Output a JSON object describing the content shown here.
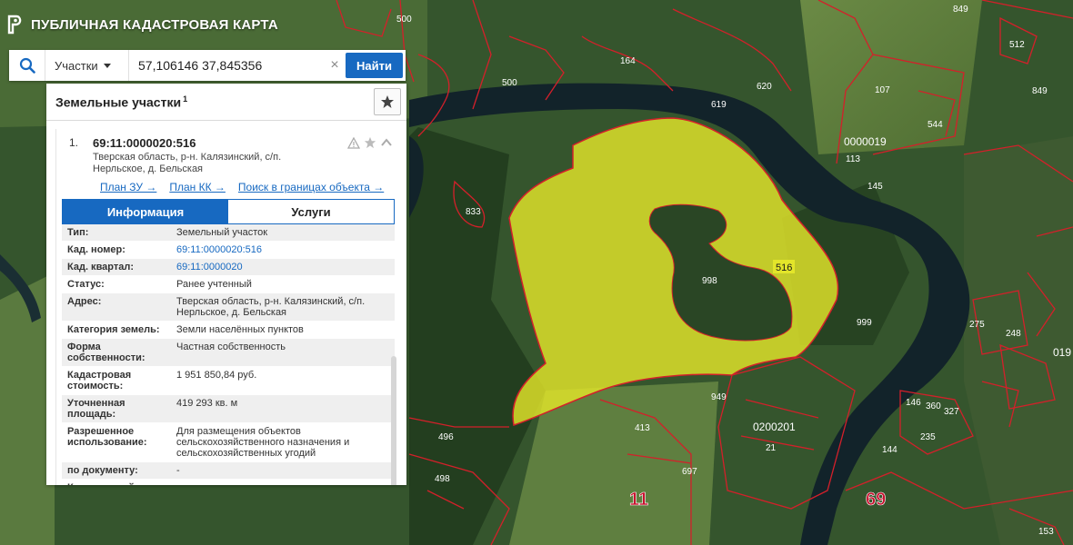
{
  "app": {
    "title": "ПУБЛИЧНАЯ КАДАСТРОВАЯ КАРТА"
  },
  "search": {
    "type_label": "Участки",
    "value": "57,106146 37,845356",
    "clear_glyph": "×",
    "button_label": "Найти"
  },
  "panel": {
    "title": "Земельные участки",
    "title_count": "1",
    "item": {
      "number": "1.",
      "cad_number": "69:11:0000020:516",
      "address_line1": "Тверская область, р-н. Калязинский, с/п.",
      "address_line2": "Нерльское, д. Бельская",
      "links": [
        "План ЗУ →",
        "План КК →",
        "Поиск в границах объекта →"
      ]
    },
    "tabs": [
      {
        "label": "Информация",
        "active": true
      },
      {
        "label": "Услуги",
        "active": false
      }
    ],
    "properties": [
      {
        "key": "Тип:",
        "value": "Земельный участок",
        "link": false
      },
      {
        "key": "Кад. номер:",
        "value": "69:11:0000020:516",
        "link": true
      },
      {
        "key": "Кад. квартал:",
        "value": "69:11:0000020",
        "link": true
      },
      {
        "key": "Статус:",
        "value": "Ранее учтенный",
        "link": false
      },
      {
        "key": "Адрес:",
        "value": "Тверская область, р-н. Калязинский, с/п. Нерльское, д. Бельская",
        "link": false
      },
      {
        "key": "Категория земель:",
        "value": "Земли населённых пунктов",
        "link": false
      },
      {
        "key": "Форма собственности:",
        "value": "Частная собственность",
        "link": false
      },
      {
        "key": "Кадастровая стоимость:",
        "value": "1 951 850,84 руб.",
        "link": false
      },
      {
        "key": "Уточненная площадь:",
        "value": "419 293 кв. м",
        "link": false
      },
      {
        "key": "Разрешенное использование:",
        "value": "Для размещения объектов сельскохозяйственного назначения и сельскохозяйственных угодий",
        "link": false
      },
      {
        "key": "по документу:",
        "value": "-",
        "link": false
      },
      {
        "key": "Кадастровый инженер:",
        "value": "-",
        "link": false
      }
    ]
  },
  "map": {
    "selected_label": "516",
    "parcel_labels": [
      "500",
      "164",
      "500",
      "620",
      "619",
      "107",
      "849",
      "849",
      "512",
      "0000019",
      "113",
      "544",
      "145",
      "833",
      "998",
      "999",
      "275",
      "248",
      "019",
      "413",
      "496",
      "498",
      "697",
      "949",
      "0200201",
      "21",
      "146",
      "360",
      "327",
      "144",
      "235",
      "11",
      "69",
      "153"
    ],
    "big_labels": [
      "11",
      "69"
    ],
    "colors": {
      "selected_fill": "#e3e52a",
      "boundary": "#d3202a",
      "river": "#12232a",
      "forest": "#2c4a25",
      "field": "#5d7c3a"
    }
  }
}
